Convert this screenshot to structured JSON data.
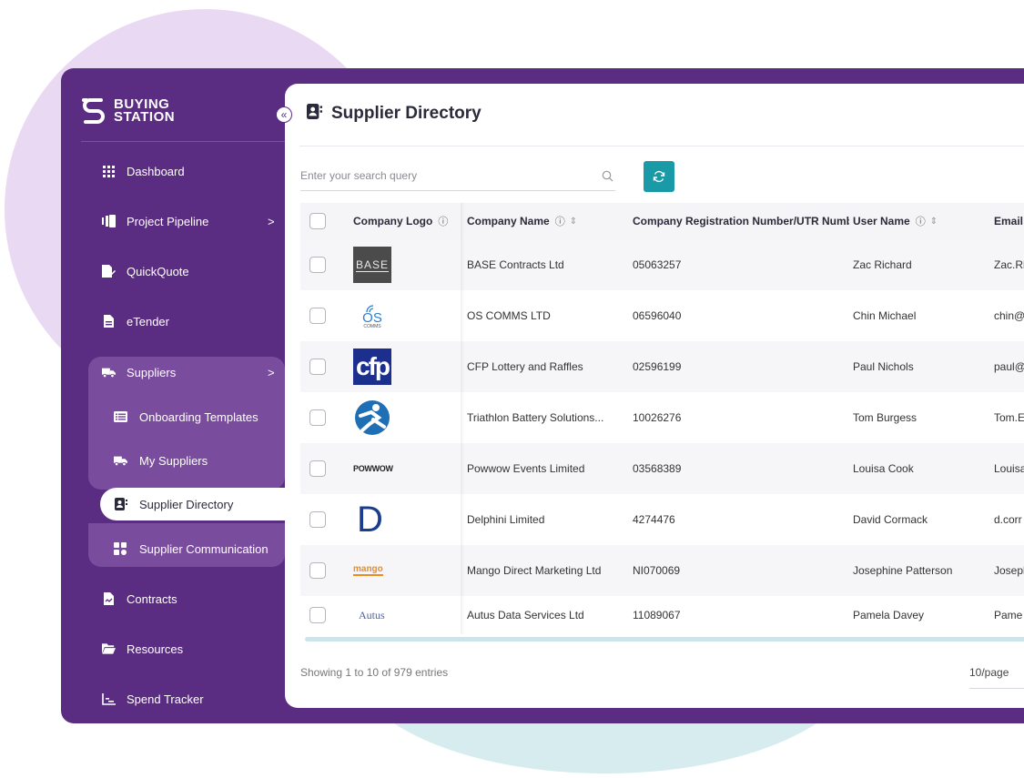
{
  "brand": {
    "line1": "BUYING",
    "line2": "STATION"
  },
  "sidebar": {
    "items": [
      {
        "label": "Dashboard",
        "icon": "grid-icon"
      },
      {
        "label": "Project Pipeline",
        "icon": "pipeline-icon",
        "chevron": ">"
      },
      {
        "label": "QuickQuote",
        "icon": "quickquote-icon"
      },
      {
        "label": "eTender",
        "icon": "document-icon"
      },
      {
        "label": "Suppliers",
        "icon": "truck-icon",
        "chevron": ">"
      },
      {
        "label": "Onboarding Templates",
        "icon": "list-icon"
      },
      {
        "label": "My Suppliers",
        "icon": "truck-icon"
      },
      {
        "label": "Supplier Directory",
        "icon": "contact-book-icon"
      },
      {
        "label": "Supplier Communication",
        "icon": "communication-icon"
      },
      {
        "label": "Contracts",
        "icon": "contract-icon"
      },
      {
        "label": "Resources",
        "icon": "folder-icon"
      },
      {
        "label": "Spend Tracker",
        "icon": "chart-icon"
      }
    ],
    "collapse_glyph": "«"
  },
  "header": {
    "title": "Supplier Directory"
  },
  "search": {
    "placeholder": "Enter your search query"
  },
  "table": {
    "columns": [
      {
        "label": "Company Logo"
      },
      {
        "label": "Company Name"
      },
      {
        "label": "Company Registration Number/UTR Number"
      },
      {
        "label": "User Name"
      },
      {
        "label": "Email"
      }
    ],
    "info_glyph": "ⓘ",
    "sort_glyph": "⇕",
    "rows": [
      {
        "logo": "BASE",
        "name": "BASE Contracts Ltd",
        "reg": "05063257",
        "user": "Zac Richard",
        "email": "Zac.Ri"
      },
      {
        "logo": "OS",
        "logo_sub": "COMMS",
        "name": "OS COMMS LTD",
        "reg": "06596040",
        "user": "Chin Michael",
        "email": "chin@"
      },
      {
        "logo": "cfp",
        "name": "CFP Lottery and Raffles",
        "reg": "02596199",
        "user": "Paul Nichols",
        "email": "paul@"
      },
      {
        "logo": "",
        "name": "Triathlon Battery Solutions...",
        "reg": "10026276",
        "user": "Tom Burgess",
        "email": "Tom.E"
      },
      {
        "logo": "POWWOW",
        "name": "Powwow Events Limited",
        "reg": "03568389",
        "user": "Louisa Cook",
        "email": "Louisa"
      },
      {
        "logo": "D",
        "name": "Delphini Limited",
        "reg": "4274476",
        "user": "David Cormack",
        "email": "d.corr"
      },
      {
        "logo": "mango",
        "name": "Mango Direct Marketing Ltd",
        "reg": "NI070069",
        "user": "Josephine Patterson",
        "email": "Josepl"
      },
      {
        "logo": "Autus",
        "name": "Autus Data Services Ltd",
        "reg": "11089067",
        "user": "Pamela Davey",
        "email": "Pame"
      }
    ]
  },
  "footer": {
    "showing": "Showing 1 to 10 of 979 entries",
    "page_size": "10/page"
  },
  "colors": {
    "sidebar": "#5b2d82",
    "submenu": "#7a4c9e",
    "accent": "#1a9aa6"
  }
}
